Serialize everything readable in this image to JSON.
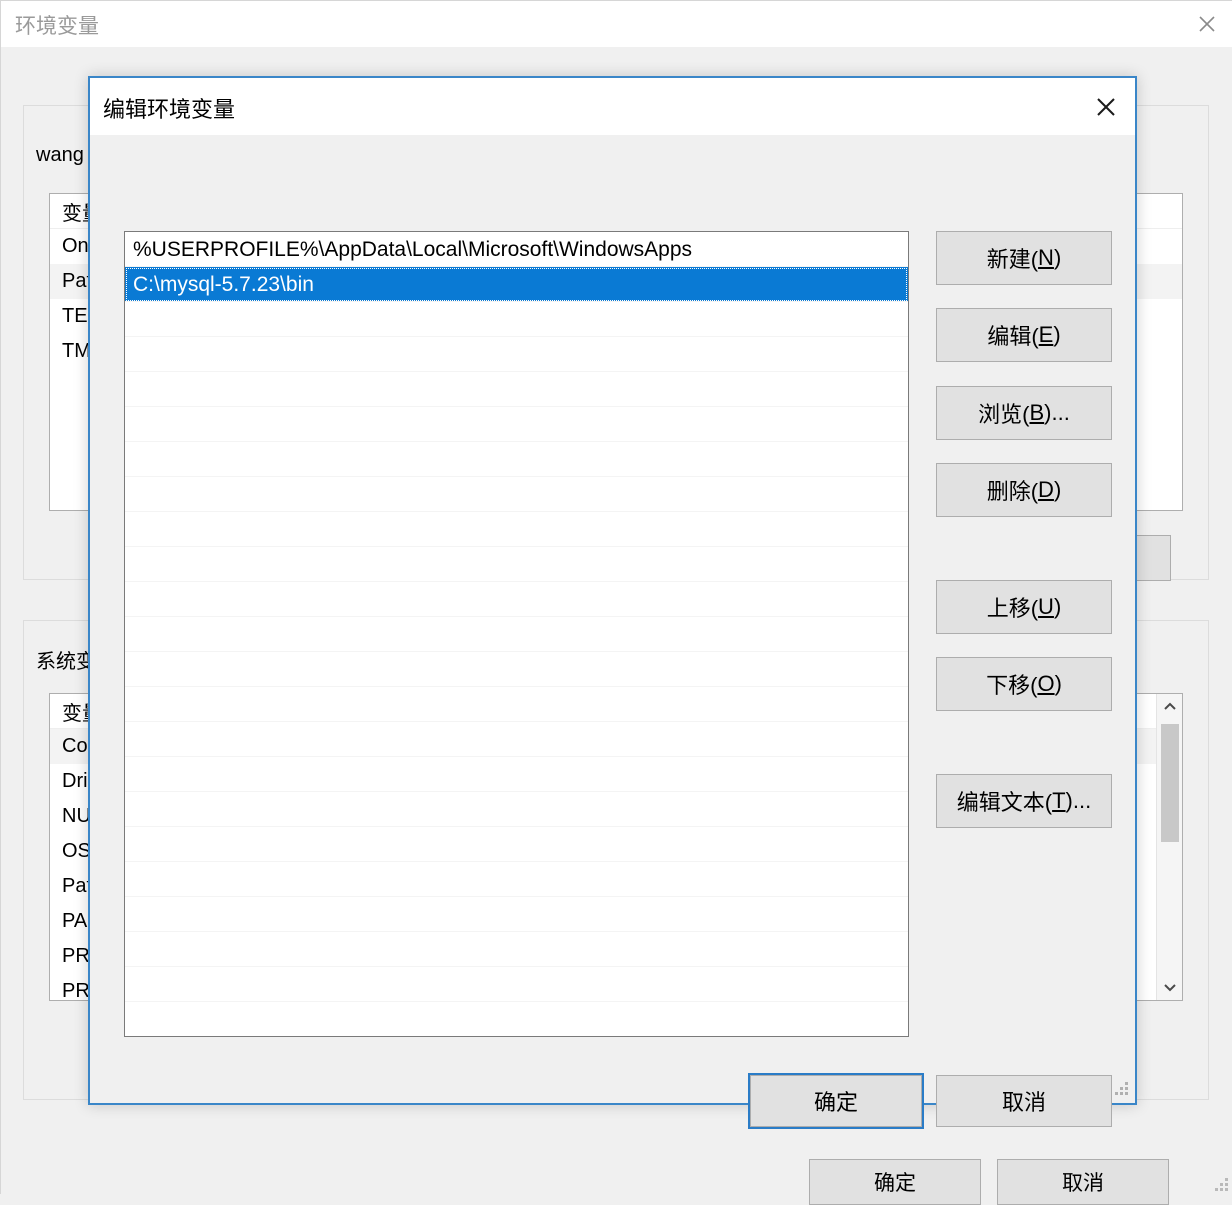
{
  "background_window": {
    "title": "环境变量",
    "close_icon": "close-icon",
    "user_section": {
      "label": "wang",
      "header": "变量",
      "rows": [
        "On",
        "Pat",
        "TEI",
        "TM"
      ]
    },
    "system_section": {
      "label": "系统变",
      "header": "变量",
      "rows": [
        "Co",
        "Dri",
        "NU",
        "OS",
        "Pat",
        "PA",
        "PR",
        "PR"
      ],
      "scrollbar": {
        "up_icon": "chevron-up-icon",
        "down_icon": "chevron-down-icon"
      }
    },
    "buttons": {
      "new_user": "",
      "edit_user": "",
      "ok": "确定",
      "cancel": "取消"
    },
    "resize_grip": "resize-grip-icon"
  },
  "dialog": {
    "title": "编辑环境变量",
    "close_icon": "close-icon",
    "path_list": {
      "entries": [
        {
          "value": "%USERPROFILE%\\AppData\\Local\\Microsoft\\WindowsApps",
          "selected": false
        },
        {
          "value": "C:\\mysql-5.7.23\\bin",
          "selected": true
        }
      ],
      "empty_row_count": 21,
      "selection_color": "#0a7ad4"
    },
    "side_buttons": [
      {
        "label_pre": "新建(",
        "accel": "N",
        "label_post": ")"
      },
      {
        "label_pre": "编辑(",
        "accel": "E",
        "label_post": ")"
      },
      {
        "label_pre": "浏览(",
        "accel": "B",
        "label_post": ")..."
      },
      {
        "label_pre": "删除(",
        "accel": "D",
        "label_post": ")"
      },
      {
        "label_pre": "上移(",
        "accel": "U",
        "label_post": ")"
      },
      {
        "label_pre": "下移(",
        "accel": "O",
        "label_post": ")"
      },
      {
        "label_pre": "编辑文本(",
        "accel": "T",
        "label_post": ")..."
      }
    ],
    "ok_label": "确定",
    "cancel_label": "取消",
    "accent_color": "#3a86c8",
    "resize_grip": "resize-grip-icon"
  }
}
